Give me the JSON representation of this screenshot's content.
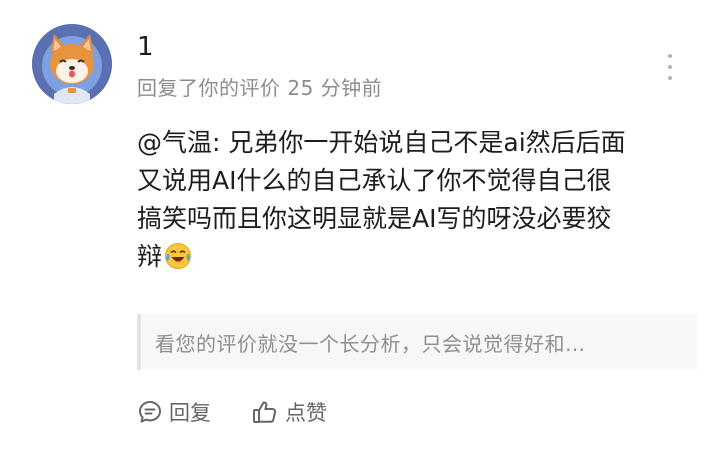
{
  "user": {
    "name": "1",
    "meta": "回复了你的评价 25 分钟前"
  },
  "comment": {
    "lines": [
      "@气温: 兄弟你一开始说自己不是ai然后后面",
      "又说用AI什么的自己承认了你不觉得自己很",
      "搞笑吗而且你这明显就是AI写的呀没必要狡",
      "辩"
    ],
    "emoji": "laughing-crying-emoji"
  },
  "quote": {
    "text": "看您的评价就没一个长分析，只会说觉得好和…"
  },
  "actions": {
    "reply_label": "回复",
    "like_label": "点赞"
  },
  "icons": {
    "avatar": "shiba-dog-avatar",
    "more": "more-vertical-icon",
    "reply": "comment-bubble-icon",
    "like": "thumbs-up-icon"
  },
  "colors": {
    "meta_text": "#8d8d8d",
    "quote_bg": "#f7f7f7",
    "quote_border": "#e2e2e2",
    "avatar_bg": "#5b6fb3"
  }
}
